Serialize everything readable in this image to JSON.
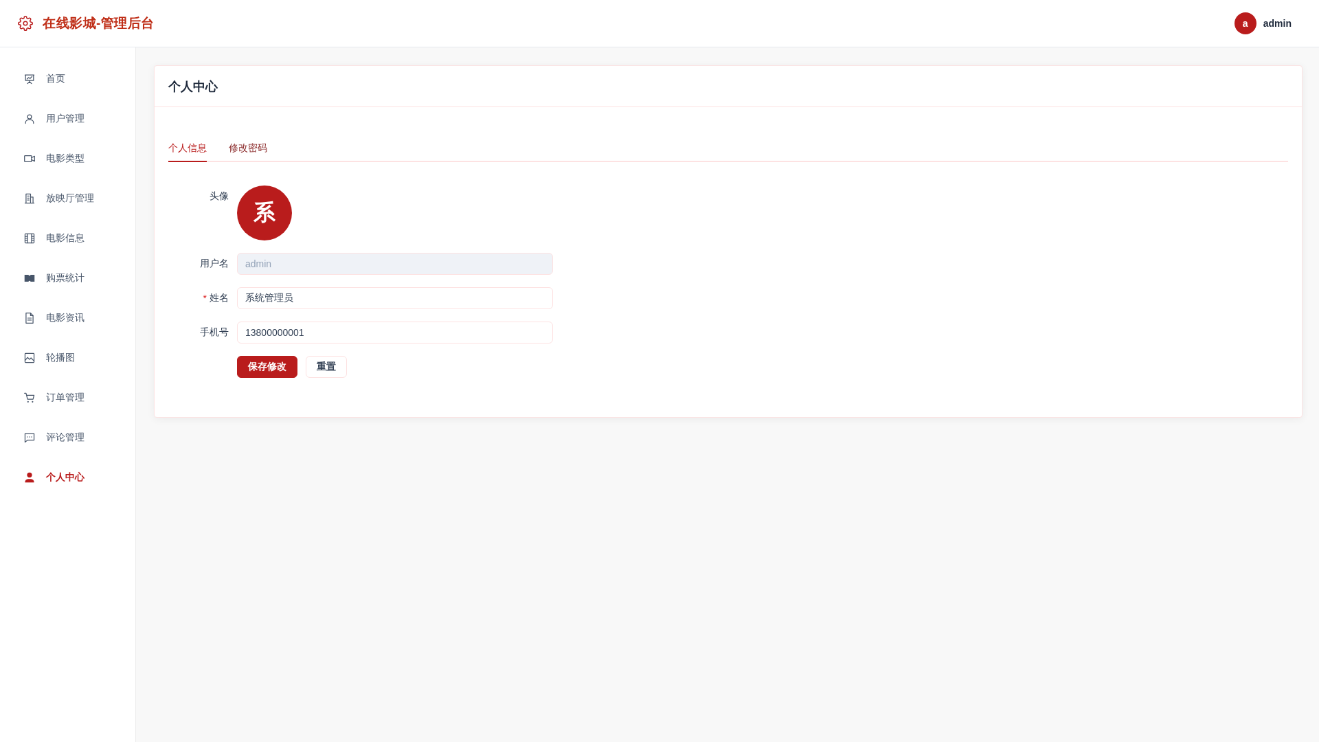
{
  "header": {
    "title": "在线影城-管理后台",
    "user": {
      "avatar_letter": "a",
      "name": "admin"
    }
  },
  "sidebar": {
    "items": [
      {
        "label": "首页",
        "selected": false
      },
      {
        "label": "用户管理",
        "selected": false
      },
      {
        "label": "电影类型",
        "selected": false
      },
      {
        "label": "放映厅管理",
        "selected": false
      },
      {
        "label": "电影信息",
        "selected": false
      },
      {
        "label": "购票统计",
        "selected": false
      },
      {
        "label": "电影资讯",
        "selected": false
      },
      {
        "label": "轮播图",
        "selected": false
      },
      {
        "label": "订单管理",
        "selected": false
      },
      {
        "label": "评论管理",
        "selected": false
      },
      {
        "label": "个人中心",
        "selected": true
      }
    ]
  },
  "card": {
    "title": "个人中心",
    "tabs": [
      {
        "label": "个人信息",
        "selected": true
      },
      {
        "label": "修改密码",
        "selected": false
      }
    ],
    "form": {
      "avatar": {
        "label": "头像",
        "letter": "系"
      },
      "fields": [
        {
          "label": "用户名",
          "value": "admin",
          "disabled": true
        },
        {
          "label": "姓名",
          "required_mark": "*",
          "value": "系统管理员",
          "disabled": false
        },
        {
          "label": "手机号",
          "value": "13800000001",
          "disabled": false
        }
      ],
      "buttons": [
        {
          "label": "保存修改",
          "kind": "primary"
        },
        {
          "label": "重置",
          "kind": "default"
        }
      ]
    }
  }
}
